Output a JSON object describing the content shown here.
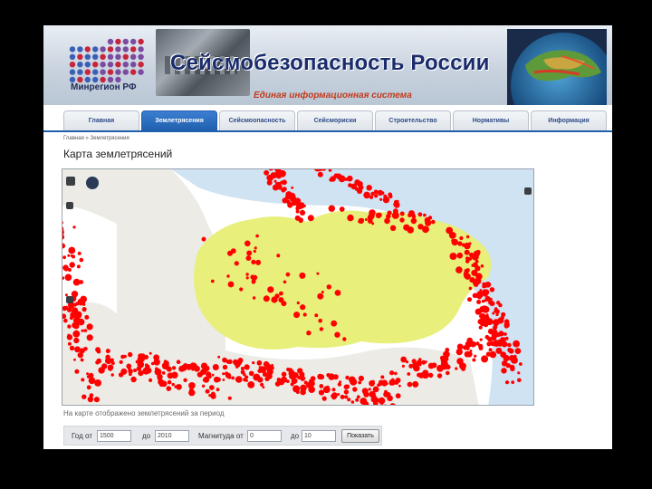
{
  "header": {
    "site_title": "Сейсмобезопасность России",
    "subtitle": "Единая информационная система",
    "logo_caption": "Минрегион РФ"
  },
  "tabs": [
    {
      "label": "Главная"
    },
    {
      "label": "Землетрясения",
      "active": true
    },
    {
      "label": "Сейсмоопасность"
    },
    {
      "label": "Сейсмориски"
    },
    {
      "label": "Строительство"
    },
    {
      "label": "Нормативы"
    },
    {
      "label": "Информация"
    }
  ],
  "breadcrumb": "Главная » Землетрясения",
  "page_title": "Карта землетрясений",
  "map_note": "На карте отображено землетрясений за период",
  "filter": {
    "year_from_label": "Год от",
    "year_from_value": "1500",
    "year_to_label": "до",
    "year_to_value": "2010",
    "mag_from_label": "Магнитуда от",
    "mag_from_value": "0",
    "mag_to_label": "до",
    "mag_to_value": "10",
    "submit_label": "Показать"
  },
  "colors": {
    "active_tab": "#1f5fae",
    "quake_marker": "#ff0000",
    "land_russia": "#e8ef7a",
    "land_other": "#ecebe6",
    "water": "#cfe3f3"
  }
}
